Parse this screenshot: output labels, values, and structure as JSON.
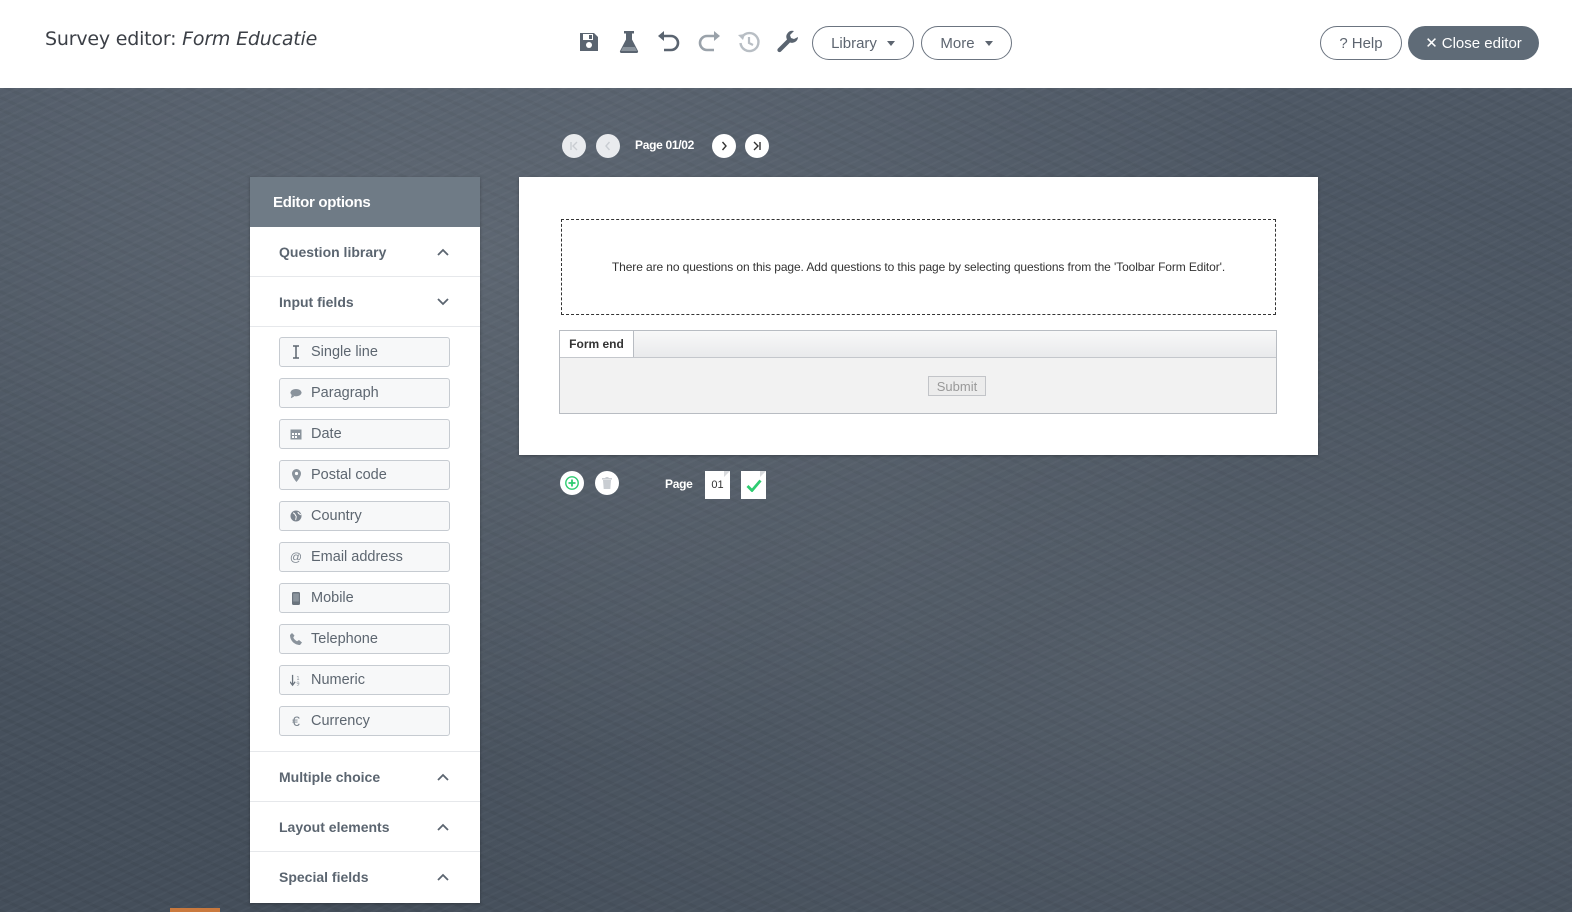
{
  "header": {
    "title_prefix": "Survey editor:",
    "title_form": "Form Educatie",
    "toolbar_icons": [
      "save-icon",
      "flask-icon",
      "undo-icon",
      "redo-icon",
      "history-icon",
      "wrench-icon"
    ],
    "library_label": "Library",
    "more_label": "More",
    "help_label": "Help",
    "close_label": "Close editor"
  },
  "pager": {
    "top_label": "Page 01/02",
    "bottom_label": "Page",
    "current_page": "01"
  },
  "sidebar": {
    "title": "Editor options",
    "sections": {
      "question_library": "Question library",
      "input_fields": "Input fields",
      "multiple_choice": "Multiple choice",
      "layout_elements": "Layout elements",
      "special_fields": "Special fields"
    },
    "fields": [
      {
        "label": "Single line",
        "icon": "text-cursor-icon"
      },
      {
        "label": "Paragraph",
        "icon": "comment-icon"
      },
      {
        "label": "Date",
        "icon": "calendar-icon"
      },
      {
        "label": "Postal code",
        "icon": "map-pin-icon"
      },
      {
        "label": "Country",
        "icon": "globe-icon"
      },
      {
        "label": "Email address",
        "icon": "at-icon"
      },
      {
        "label": "Mobile",
        "icon": "mobile-icon"
      },
      {
        "label": "Telephone",
        "icon": "phone-icon"
      },
      {
        "label": "Numeric",
        "icon": "sort-numeric-icon"
      },
      {
        "label": "Currency",
        "icon": "euro-icon"
      }
    ]
  },
  "page": {
    "empty_message": "There are no questions on this page. Add questions to this page by selecting questions from the 'Toolbar Form Editor'.",
    "form_end_label": "Form end",
    "submit_label": "Submit"
  },
  "colors": {
    "accent": "#5f6b77",
    "sidebar_header": "#6f7b86",
    "add_green": "#2ecc71"
  }
}
